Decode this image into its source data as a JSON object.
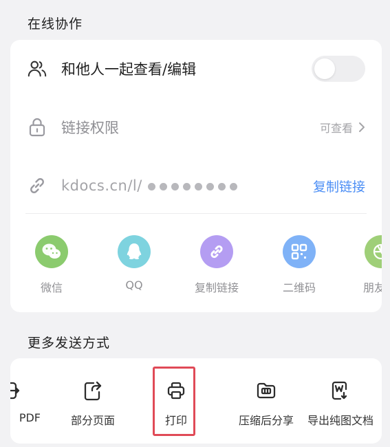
{
  "collab": {
    "section_title": "在线协作",
    "co_edit_label": "和他人一起查看/编辑",
    "co_edit_enabled": false,
    "permission_label": "链接权限",
    "permission_value": "可查看",
    "link_prefix": "kdocs.cn/l/",
    "copy_link_label": "复制链接"
  },
  "share_targets": [
    {
      "label": "微信",
      "icon": "wechat-icon",
      "color": "#8bcb6e"
    },
    {
      "label": "QQ",
      "icon": "qq-icon",
      "color": "#7ed3df"
    },
    {
      "label": "复制链接",
      "icon": "link-icon",
      "color": "#b49df2"
    },
    {
      "label": "二维码",
      "icon": "qrcode-icon",
      "color": "#7fb2f7"
    },
    {
      "label": "朋友",
      "icon": "moments-icon",
      "color": "#9fcf78"
    }
  ],
  "more": {
    "section_title": "更多发送方式",
    "items": [
      {
        "label": "PDF",
        "icon": "pdf-export-icon"
      },
      {
        "label": "部分页面",
        "icon": "partial-page-icon"
      },
      {
        "label": "打印",
        "icon": "printer-icon",
        "highlighted": true
      },
      {
        "label": "压缩后分享",
        "icon": "zip-folder-icon"
      },
      {
        "label": "导出纯图文档",
        "icon": "image-doc-icon"
      }
    ]
  },
  "colors": {
    "accent": "#4d8ff5",
    "highlight": "#e04a57",
    "background": "#f2f2f4"
  }
}
